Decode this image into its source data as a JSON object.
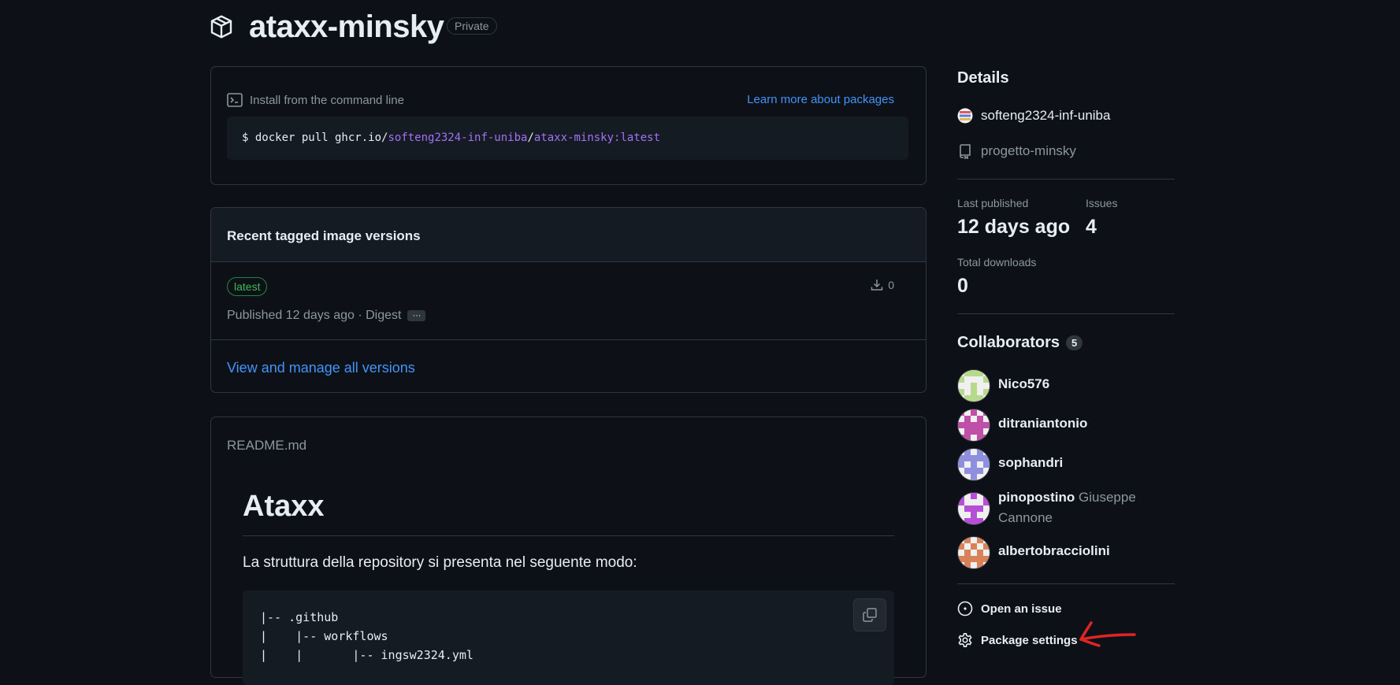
{
  "header": {
    "title": "ataxx-minsky",
    "visibility": "Private",
    "icon": "package-icon"
  },
  "install": {
    "label": "Install from the command line",
    "learn_more": "Learn more about packages",
    "cmd_prefix": "$ docker pull ghcr.io/",
    "cmd_owner": "softeng2324-inf-uniba",
    "cmd_sep": "/",
    "cmd_image": "ataxx-minsky:latest"
  },
  "versions": {
    "title": "Recent tagged image versions",
    "tag": "latest",
    "downloads": "0",
    "published": "Published 12 days ago · Digest",
    "more": "···",
    "view_all": "View and manage all versions"
  },
  "readme": {
    "filename": "README.md",
    "heading": "Ataxx",
    "paragraph": "La struttura della repository si presenta nel seguente modo:",
    "code_lines": [
      "|-- .github",
      "|    |-- workflows",
      "|    |       |-- ingsw2324.yml"
    ]
  },
  "sidebar": {
    "details_title": "Details",
    "owner": "softeng2324-inf-uniba",
    "repo": "progetto-minsky",
    "last_published_label": "Last published",
    "last_published_value": "12 days ago",
    "issues_label": "Issues",
    "issues_value": "4",
    "downloads_label": "Total downloads",
    "downloads_value": "0",
    "collaborators_title": "Collaborators",
    "collaborators_count": "5",
    "collaborators": [
      {
        "login": "Nico576",
        "full": "",
        "color": "#b7d98b"
      },
      {
        "login": "ditraniantonio",
        "full": "",
        "color": "#c04fa8"
      },
      {
        "login": "sophandri",
        "full": "",
        "color": "#8f8fde"
      },
      {
        "login": "pinopostino",
        "full": "Giuseppe Cannone",
        "color": "#b64fd6"
      },
      {
        "login": "albertobracciolini",
        "full": "",
        "color": "#d9825a"
      }
    ],
    "open_issue": "Open an issue",
    "package_settings": "Package settings"
  },
  "colors": {
    "background": "#0d1117",
    "border": "#30363d",
    "link": "#4493f8",
    "tag_green": "#3fb950",
    "annotation_arrow": "#e02424"
  }
}
